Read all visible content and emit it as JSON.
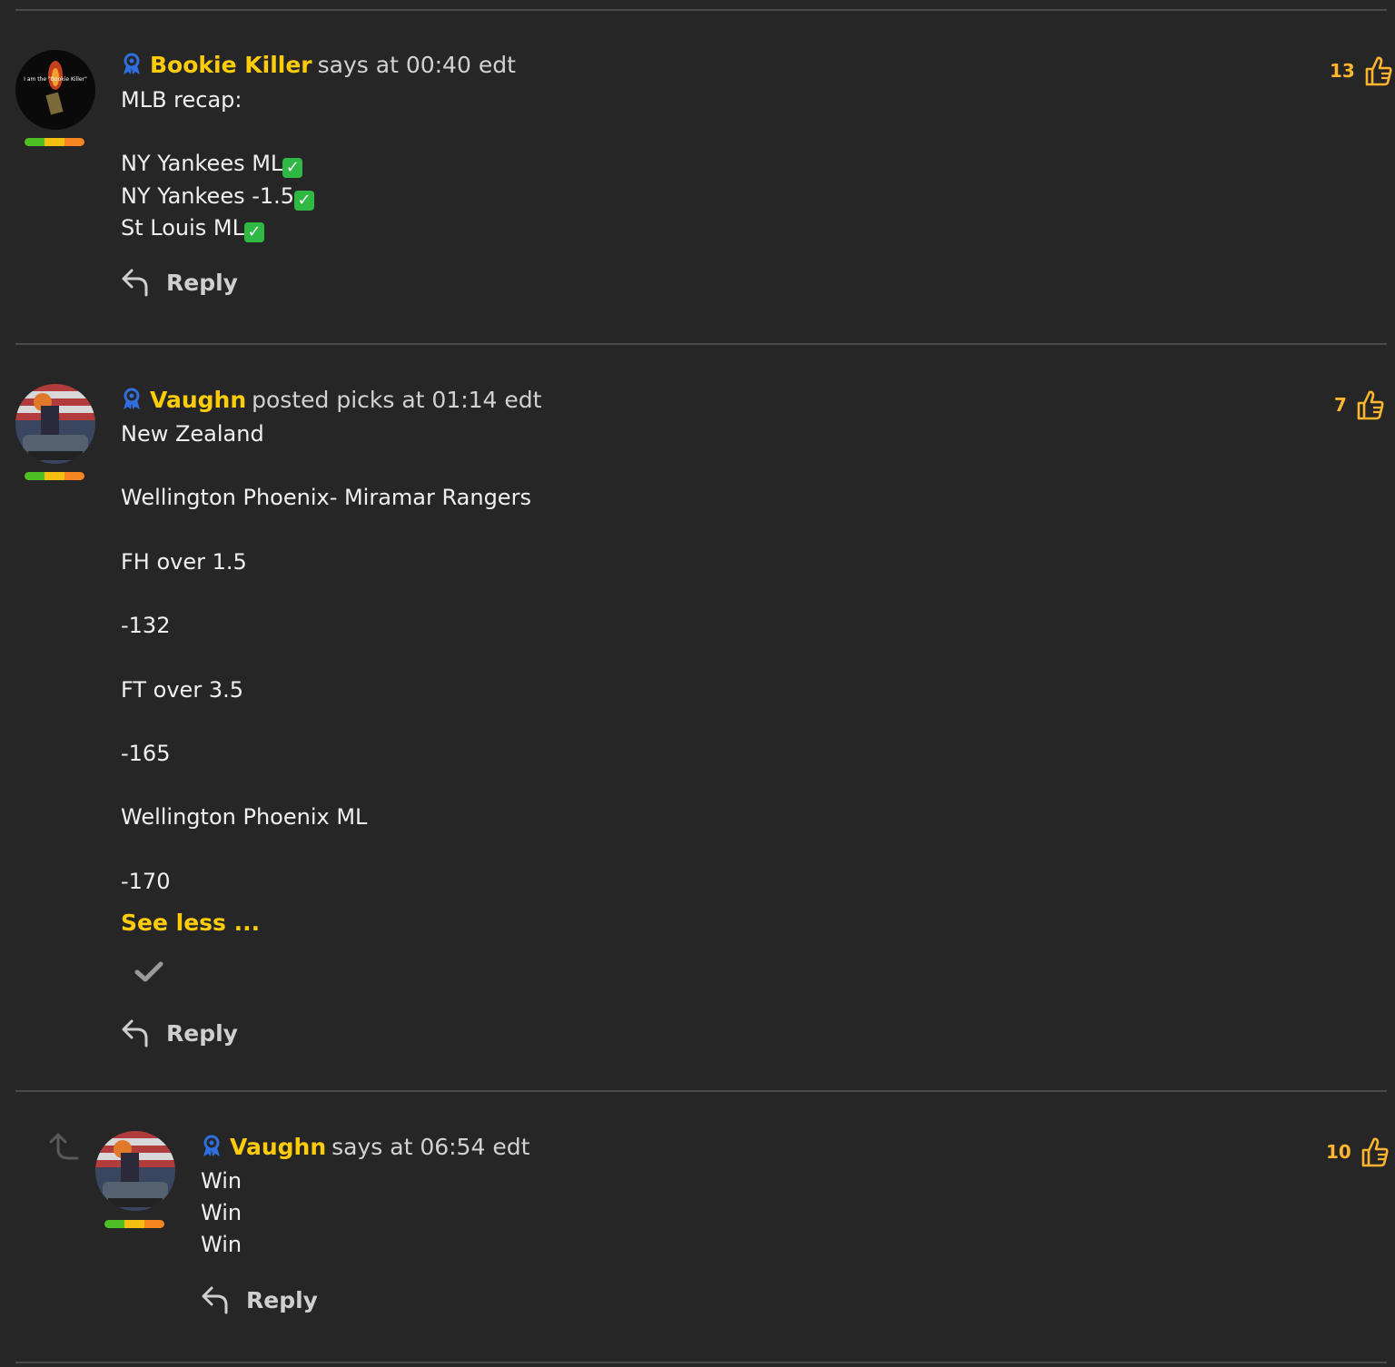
{
  "comments": [
    {
      "author": "Bookie Killer",
      "action": "says at 00:40 edt",
      "lines": [
        "MLB recap:",
        "",
        "NY Yankees ML",
        "NY Yankees -1.5",
        "St Louis ML"
      ],
      "avatar_text": "I am the \"Bookie Killer\"",
      "likes": "13",
      "reply_label": "Reply"
    },
    {
      "author": "Vaughn",
      "action": "posted picks at 01:14 edt",
      "lines": [
        "New Zealand",
        "",
        "Wellington Phoenix- Miramar Rangers",
        "",
        "FH over 1.5",
        "",
        "-132",
        "",
        "FT over 3.5",
        "",
        "-165",
        "",
        "Wellington Phoenix ML",
        "",
        "-170"
      ],
      "see_less": "See less ...",
      "likes": "7",
      "reply_label": "Reply"
    },
    {
      "author": "Vaughn",
      "action": "says at 06:54 edt",
      "lines": [
        "Win",
        "Win",
        "Win"
      ],
      "likes": "10",
      "reply_label": "Reply"
    }
  ],
  "colors": {
    "background": "#262626",
    "author": "#ffcc0a",
    "likes": "#ffb52e",
    "badge": "#2f6fe0",
    "check": "#2fb844"
  },
  "icons": [
    "badge-icon",
    "thumbs-up-icon",
    "reply-icon",
    "check-icon",
    "thread-arrow-icon"
  ]
}
